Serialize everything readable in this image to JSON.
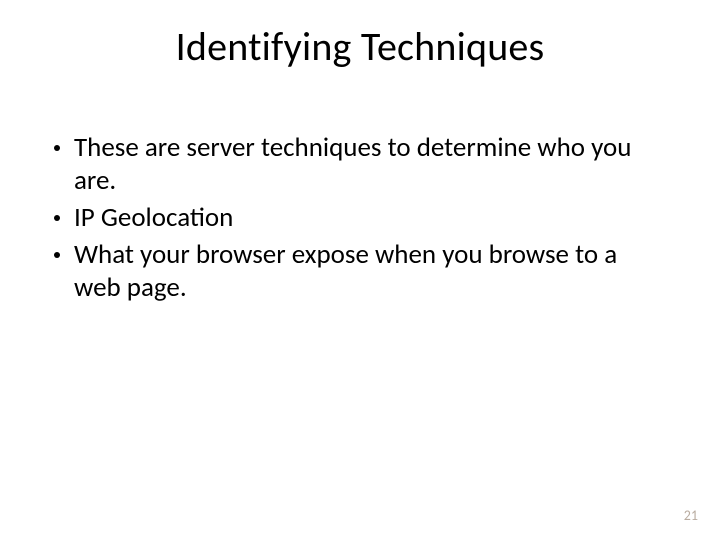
{
  "title": "Identifying Techniques",
  "bullets": [
    "These are server techniques to determine who you are.",
    "IP Geolocation",
    "What your browser expose when you browse to a web page."
  ],
  "pageNumber": "21"
}
